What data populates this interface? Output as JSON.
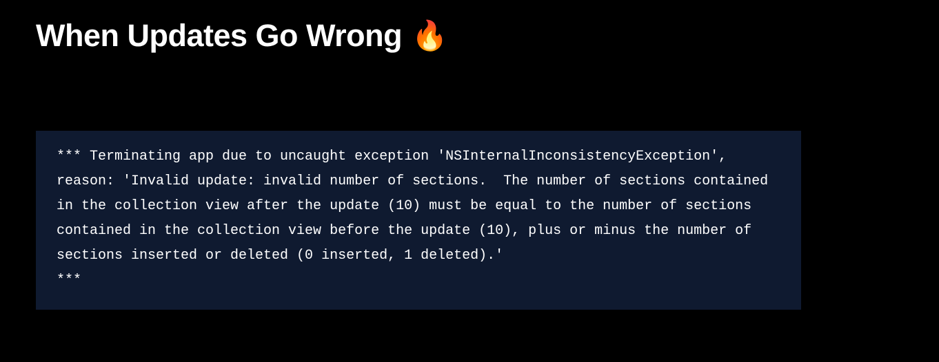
{
  "slide": {
    "title": "When Updates Go Wrong",
    "emoji": "🔥",
    "code_block": "*** Terminating app due to uncaught exception 'NSInternalInconsistencyException', reason: 'Invalid update: invalid number of sections.  The number of sections contained in the collection view after the update (10) must be equal to the number of sections contained in the collection view before the update (10), plus or minus the number of sections inserted or deleted (0 inserted, 1 deleted).'\n***"
  }
}
